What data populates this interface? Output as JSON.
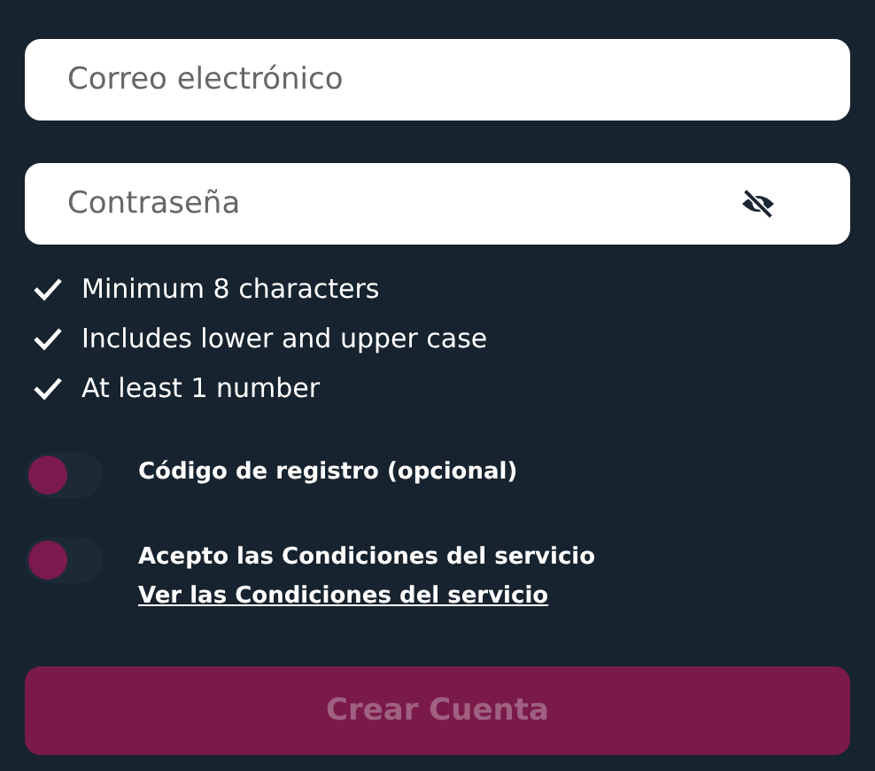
{
  "email_field": {
    "placeholder": "Correo electrónico"
  },
  "password_field": {
    "placeholder": "Contraseña",
    "password_visible": false
  },
  "requirements": [
    {
      "text": "Minimum 8 characters",
      "met": true
    },
    {
      "text": "Includes lower and upper case",
      "met": true
    },
    {
      "text": "At least 1 number",
      "met": true
    }
  ],
  "toggles": [
    {
      "label": "Código de registro (opcional)",
      "on": false
    },
    {
      "label": "Acepto las Condiciones del servicio",
      "link": "Ver las Condiciones del servicio",
      "on": false
    }
  ],
  "submit_button": {
    "label": "Crear Cuenta",
    "disabled": true
  }
}
